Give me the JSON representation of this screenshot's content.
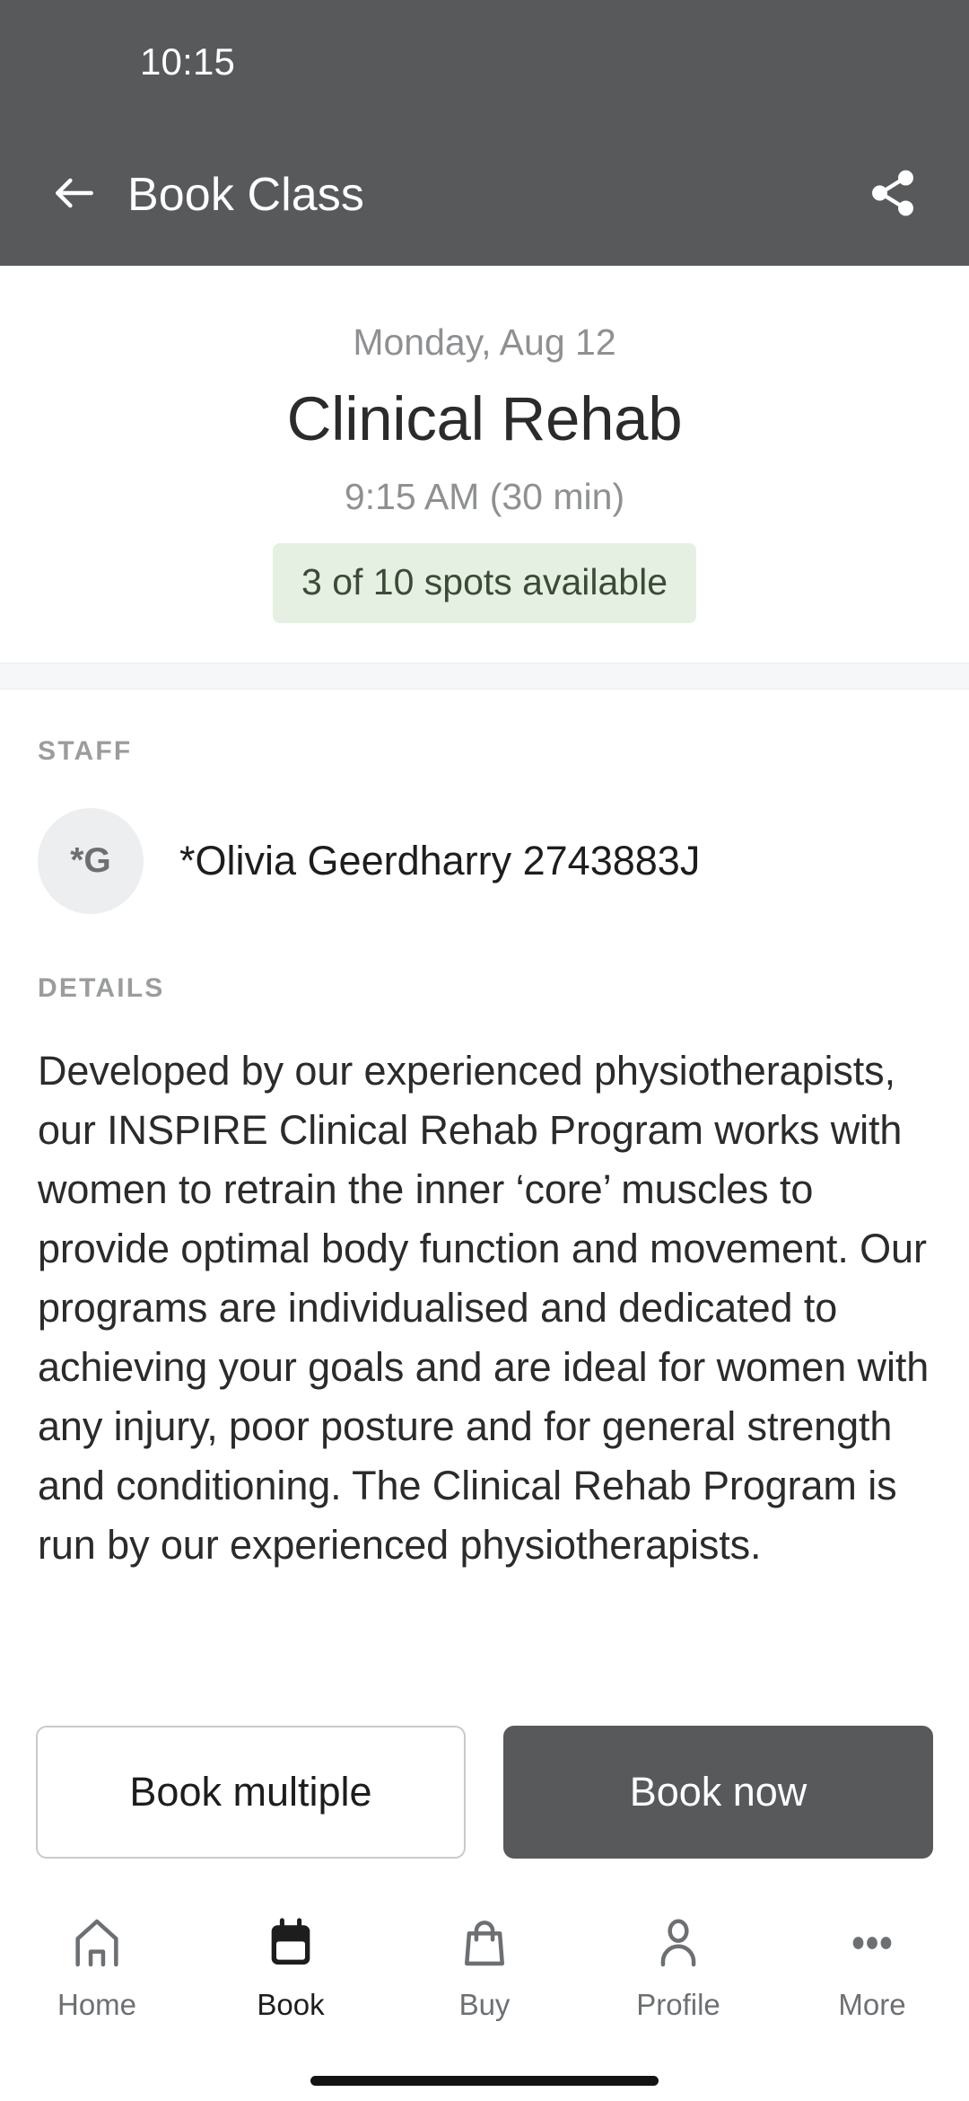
{
  "status_bar": {
    "time": "10:15"
  },
  "app_bar": {
    "title": "Book Class",
    "back_icon": "arrow-left-icon",
    "share_icon": "share-icon"
  },
  "hero": {
    "date": "Monday, Aug 12",
    "class_name": "Clinical Rehab",
    "time_and_duration": "9:15 AM (30 min)",
    "spots_badge": "3 of 10 spots available",
    "spots_badge_bg": "#e5f0e2",
    "spots_badge_text_color": "#3c4a38"
  },
  "staff": {
    "section_label": "STAFF",
    "avatar_initials": "*G",
    "name": "*Olivia Geerdharry 2743883J"
  },
  "details": {
    "section_label": "DETAILS",
    "body": "Developed by our experienced physiotherapists, our INSPIRE Clinical Rehab Program works with women to retrain the inner ‘core’ muscles to provide optimal body function and movement. Our programs are individualised and dedicated to achieving your goals and are ideal for women with any injury, poor posture and for general strength and conditioning.   The Clinical Rehab Program is run by our experienced physiotherapists."
  },
  "cta": {
    "secondary_label": "Book multiple",
    "primary_label": "Book now",
    "primary_bg": "#58595b"
  },
  "bottom_nav": {
    "items": [
      {
        "label": "Home",
        "icon": "home-icon",
        "active": false
      },
      {
        "label": "Book",
        "icon": "calendar-icon",
        "active": true
      },
      {
        "label": "Buy",
        "icon": "bag-icon",
        "active": false
      },
      {
        "label": "Profile",
        "icon": "person-icon",
        "active": false
      },
      {
        "label": "More",
        "icon": "ellipsis-icon",
        "active": false
      }
    ]
  },
  "theme": {
    "header_bg": "#58595b",
    "page_bg": "#ffffff",
    "muted_text": "#8e9092"
  }
}
